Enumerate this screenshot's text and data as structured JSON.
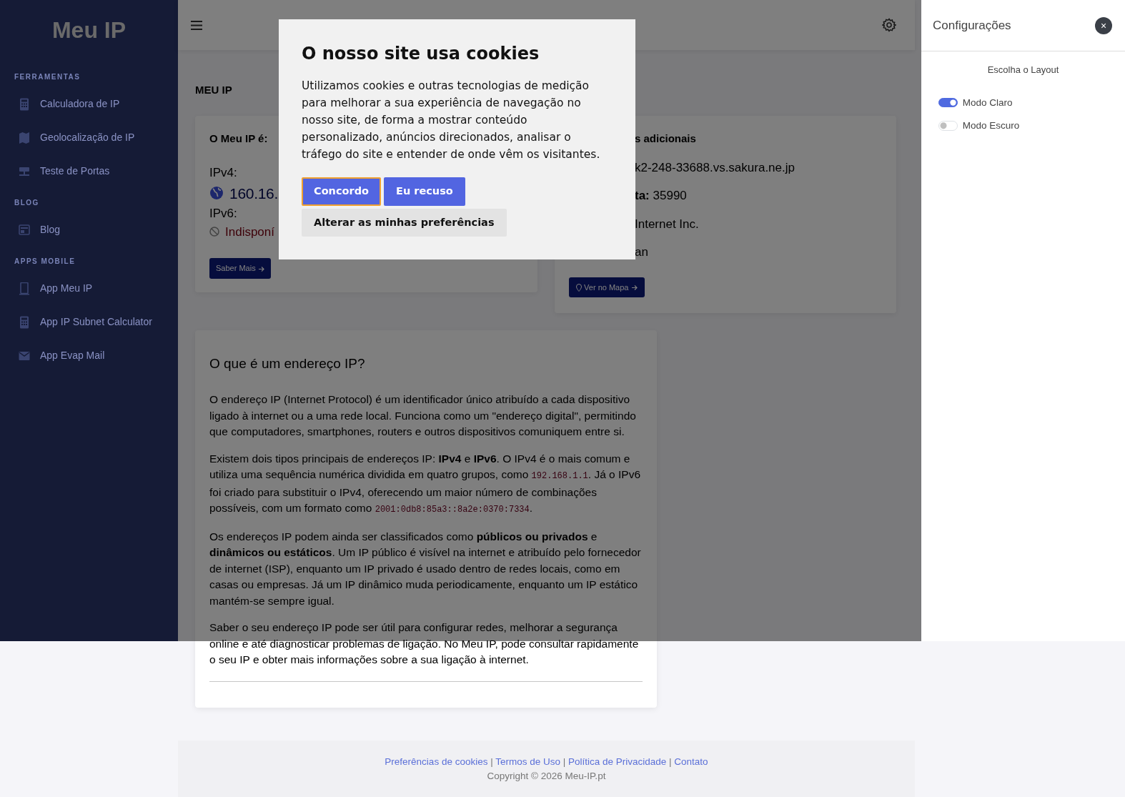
{
  "sidebar": {
    "logo": "Meu IP",
    "sections": [
      {
        "heading": "FERRAMENTAS",
        "items": [
          {
            "label": "Calculadora de IP"
          },
          {
            "label": "Geolocalização de IP"
          },
          {
            "label": "Teste de Portas"
          }
        ]
      },
      {
        "heading": "BLOG",
        "items": [
          {
            "label": "Blog"
          }
        ]
      },
      {
        "heading": "APPS MOBILE",
        "items": [
          {
            "label": "App Meu IP"
          },
          {
            "label": "App IP Subnet Calculator"
          },
          {
            "label": "App Evap Mail"
          }
        ]
      }
    ]
  },
  "page_title": "MEU IP",
  "ip_card": {
    "title": "O Meu IP é:",
    "ipv4_label": "IPv4:",
    "ipv4_value": "160.16.",
    "ipv6_label": "IPv6:",
    "ipv6_value": "Indisponí",
    "button": "Saber Mais"
  },
  "info_card": {
    "title": "s adicionais",
    "lines": [
      {
        "value": "k2-248-33688.vs.sakura.ne.jp"
      },
      {
        "label": "ta:",
        "value": "35990"
      },
      {
        "value": "Internet Inc."
      },
      {
        "value": "an"
      }
    ],
    "button": "Ver no Mapa"
  },
  "article": {
    "title": "O que é um endereço IP?",
    "paragraphs": [
      [
        {
          "kind": "text",
          "text": "O endereço IP (Internet Protocol) é um identificador único atribuído a cada dispositivo ligado à internet ou a uma rede local. Funciona como um \"endereço digital\", permitindo que computadores, smartphones, routers e outros dispositivos comuniquem entre si."
        }
      ],
      [
        {
          "kind": "text",
          "text": "Existem dois tipos principais de endereços IP: **IPv4** e **IPv6**. O IPv4 é o mais comum e utiliza uma sequência numérica dividida em quatro grupos, como "
        },
        {
          "kind": "code",
          "text": "192.168.1.1"
        },
        {
          "kind": "text",
          "text": ". Já o IPv6 foi criado para substituir o IPv4, oferecendo um maior número de combinações possíveis, com um formato como "
        },
        {
          "kind": "code",
          "text": "2001:0db8:85a3::8a2e:0370:7334"
        },
        {
          "kind": "text",
          "text": "."
        }
      ],
      [
        {
          "kind": "text",
          "text": "Os endereços IP podem ainda ser classificados como **públicos ou privados** e **dinâmicos ou estáticos**. Um IP público é visível na internet e atribuído pelo fornecedor de internet (ISP), enquanto um IP privado é usado dentro de redes locais, como em casas ou empresas. Já um IP dinâmico muda periodicamente, enquanto um IP estático mantém-se sempre igual."
        }
      ],
      [
        {
          "kind": "text",
          "text": "Saber o seu endereço IP pode ser útil para configurar redes, melhorar a segurança online e até diagnosticar problemas de ligação. No Meu IP, pode consultar rapidamente o seu IP e obter mais informações sobre a sua ligação à internet."
        }
      ]
    ]
  },
  "footer": {
    "links": [
      "Preferências de cookies",
      "Termos de Uso",
      "Política de Privacidade",
      "Contato"
    ],
    "separator": "|",
    "copyright": "Copyright © 2026 Meu-IP.pt"
  },
  "settings": {
    "title": "Configurações",
    "close": "×",
    "subtitle": "Escolha o Layout",
    "options": [
      {
        "label": "Modo Claro",
        "on": true
      },
      {
        "label": "Modo Escuro",
        "on": false
      }
    ]
  },
  "cookie_dialog": {
    "title": "O nosso site usa cookies",
    "text": "Utilizamos cookies e outras tecnologias de medição para melhorar a sua experiência de navegação no nosso site, de forma a mostrar conteúdo personalizado, anúncios direcionados, analisar o tráfego do site e entender de onde vêm os visitantes.",
    "buttons": [
      {
        "label": "Concordo",
        "kind": "primary",
        "focused": true
      },
      {
        "label": "Eu recuso",
        "kind": "primary",
        "focused": false
      },
      {
        "label": "Alterar as minhas preferências",
        "kind": "secondary",
        "focused": false
      }
    ]
  }
}
